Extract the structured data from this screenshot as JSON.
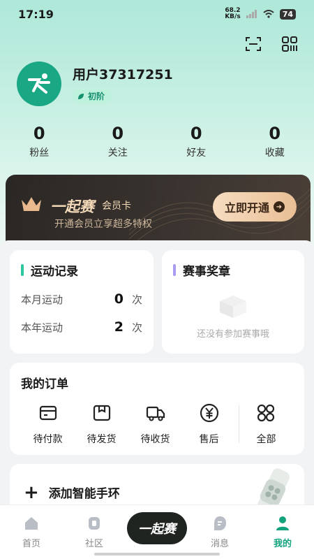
{
  "status_bar": {
    "time": "17:19",
    "net_speed": "68.2",
    "net_unit": "KB/s",
    "battery": "74"
  },
  "profile": {
    "username": "用户37317251",
    "level": "初阶"
  },
  "stats": [
    {
      "value": "0",
      "label": "粉丝"
    },
    {
      "value": "0",
      "label": "关注"
    },
    {
      "value": "0",
      "label": "好友"
    },
    {
      "value": "0",
      "label": "收藏"
    }
  ],
  "member_card": {
    "brand": "一起赛",
    "subtitle": "会员卡",
    "desc": "开通会员立享超多特权",
    "button": "立即开通"
  },
  "sport_record": {
    "title": "运动记录",
    "rows": [
      {
        "label": "本月运动",
        "value": "0",
        "unit": "次"
      },
      {
        "label": "本年运动",
        "value": "2",
        "unit": "次"
      }
    ]
  },
  "medals": {
    "title": "赛事奖章",
    "empty_text": "还没有参加赛事哦"
  },
  "orders": {
    "title": "我的订单",
    "items": [
      {
        "label": "待付款",
        "icon": "wallet-icon"
      },
      {
        "label": "待发货",
        "icon": "box-icon"
      },
      {
        "label": "待收货",
        "icon": "truck-icon"
      },
      {
        "label": "售后",
        "icon": "yen-icon"
      },
      {
        "label": "全部",
        "icon": "grid-icon"
      }
    ]
  },
  "band": {
    "label": "添加智能手环"
  },
  "tabbar": {
    "items": [
      {
        "label": "首页"
      },
      {
        "label": "社区"
      },
      {
        "label": "一起赛"
      },
      {
        "label": "消息"
      },
      {
        "label": "我的"
      }
    ]
  },
  "colors": {
    "accent": "#12a37e",
    "member_gold": "#f3d9b8",
    "sport_bar": "#2ec7a0",
    "medal_bar": "#a99cf0"
  }
}
